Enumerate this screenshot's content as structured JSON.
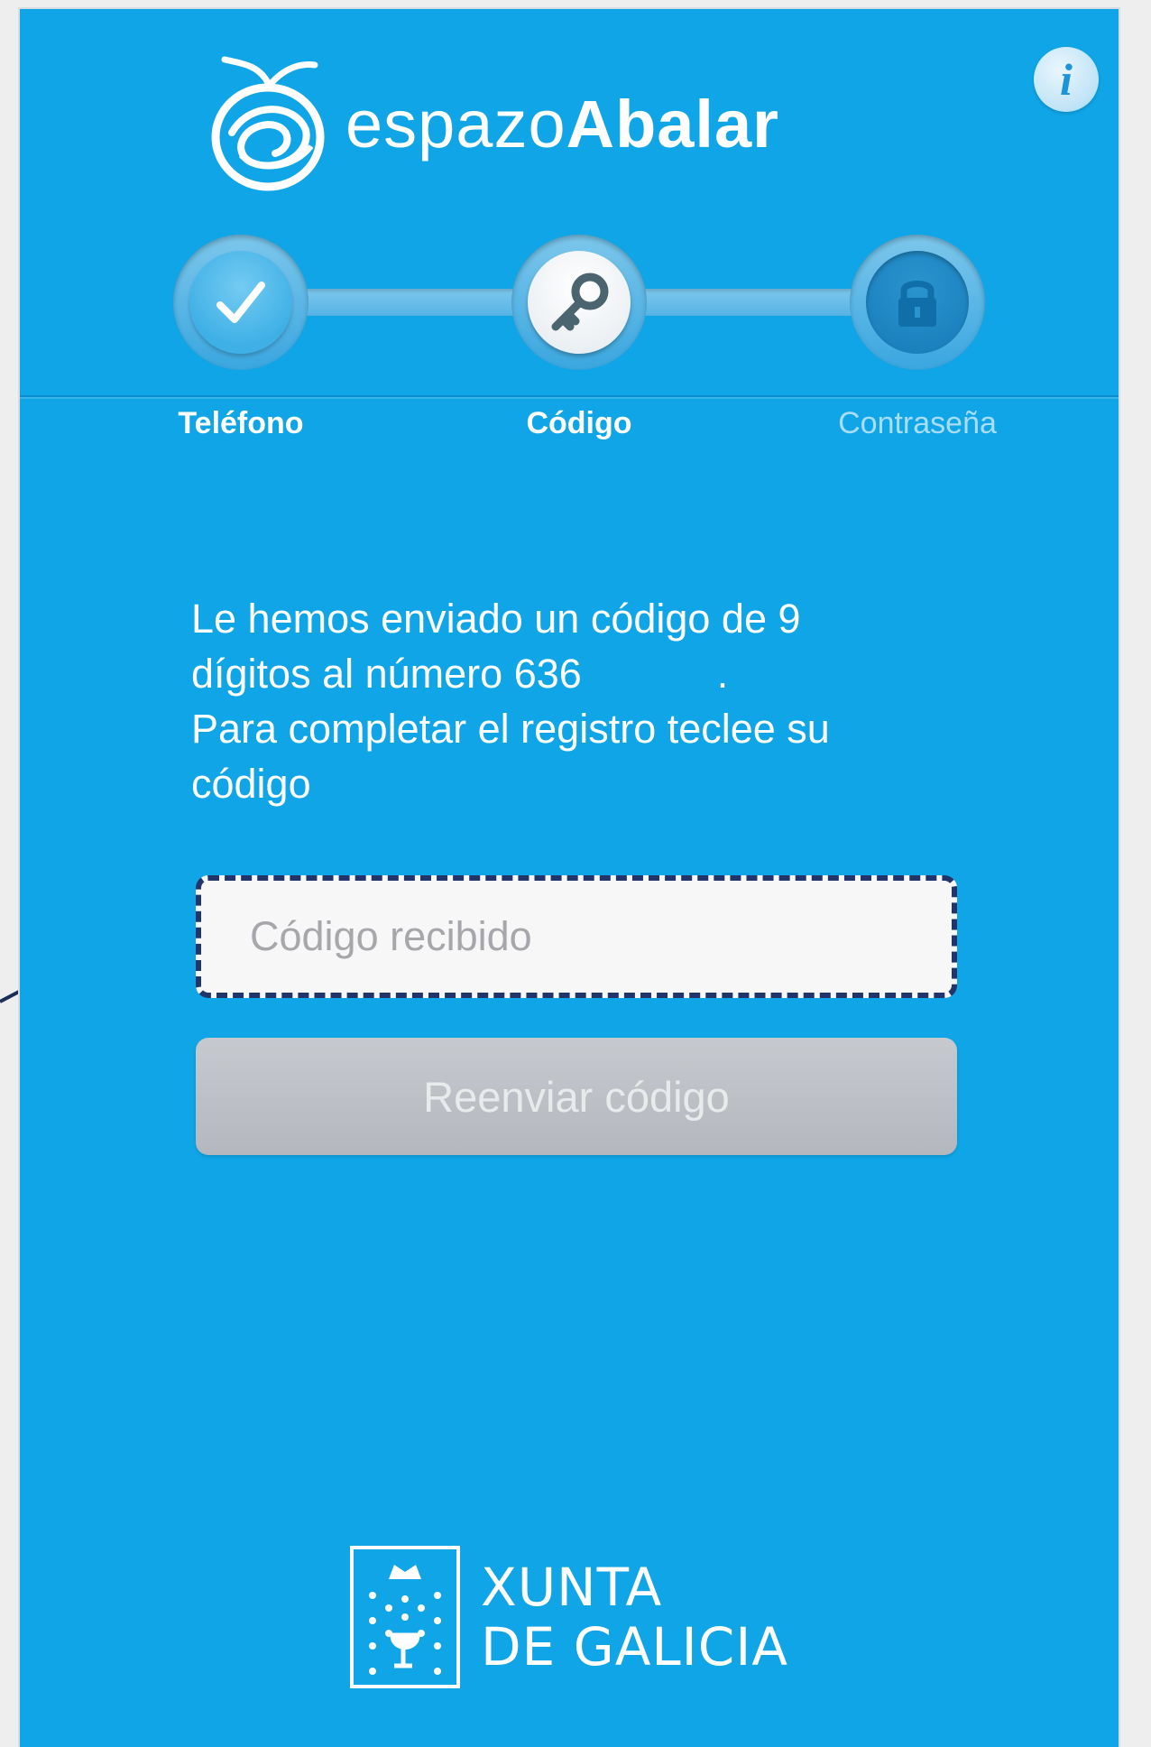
{
  "app": {
    "logo_light": "espazo",
    "logo_bold": "Abalar",
    "info_label": "i"
  },
  "steps": [
    {
      "label": "Teléfono",
      "state": "completed",
      "icon": "check-icon"
    },
    {
      "label": "Código",
      "state": "active",
      "icon": "key-icon"
    },
    {
      "label": "Contraseña",
      "state": "pending",
      "icon": "lock-icon"
    }
  ],
  "message": {
    "line1": "Le hemos enviado un código de 9",
    "line2": "dígitos al número 636            .",
    "line3": "Para completar el registro teclee su",
    "line4": "código"
  },
  "code_input": {
    "placeholder": "Código recibido",
    "value": ""
  },
  "resend_button": {
    "label": "Reenviar código"
  },
  "footer": {
    "line1": "XUNTA",
    "line2": "DE GALICIA"
  },
  "colors": {
    "background": "#0fa5e6",
    "input_border": "#21356a",
    "button_disabled": "#c0c3c8"
  }
}
